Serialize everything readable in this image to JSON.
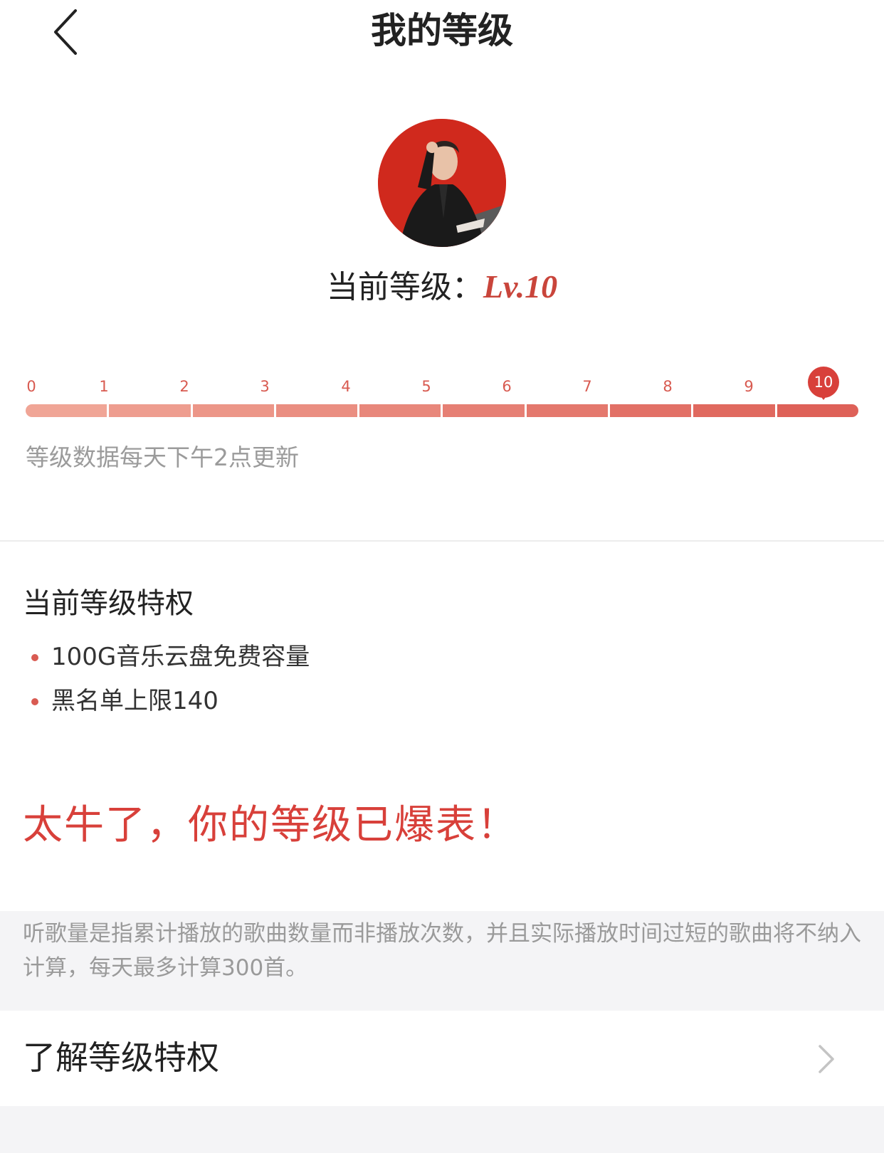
{
  "header": {
    "title": "我的等级"
  },
  "level": {
    "prefix": "当前等级：",
    "value": "Lv.10",
    "current": 10
  },
  "progress": {
    "ticks": [
      "0",
      "1",
      "2",
      "3",
      "4",
      "5",
      "6",
      "7",
      "8",
      "9",
      "10"
    ],
    "segment_colors": [
      "#f0a596",
      "#ee9d8f",
      "#ec9688",
      "#ea8e81",
      "#e8877b",
      "#e67f74",
      "#e4786d",
      "#e27066",
      "#e0695f",
      "#de6158"
    ],
    "marker_color": "#d8403a"
  },
  "update_note": "等级数据每天下午2点更新",
  "privileges": {
    "title": "当前等级特权",
    "items": [
      "100G音乐云盘免费容量",
      "黑名单上限140"
    ]
  },
  "max_message": "太牛了，你的等级已爆表！",
  "info": "听歌量是指累计播放的歌曲数量而非播放次数，并且实际播放时间过短的歌曲将不纳入计算，每天最多计算300首。",
  "link": {
    "label": "了解等级特权",
    "icon": "chevron-right-icon"
  },
  "colors": {
    "accent": "#d8403a",
    "avatar_bg": "#d0291d"
  }
}
